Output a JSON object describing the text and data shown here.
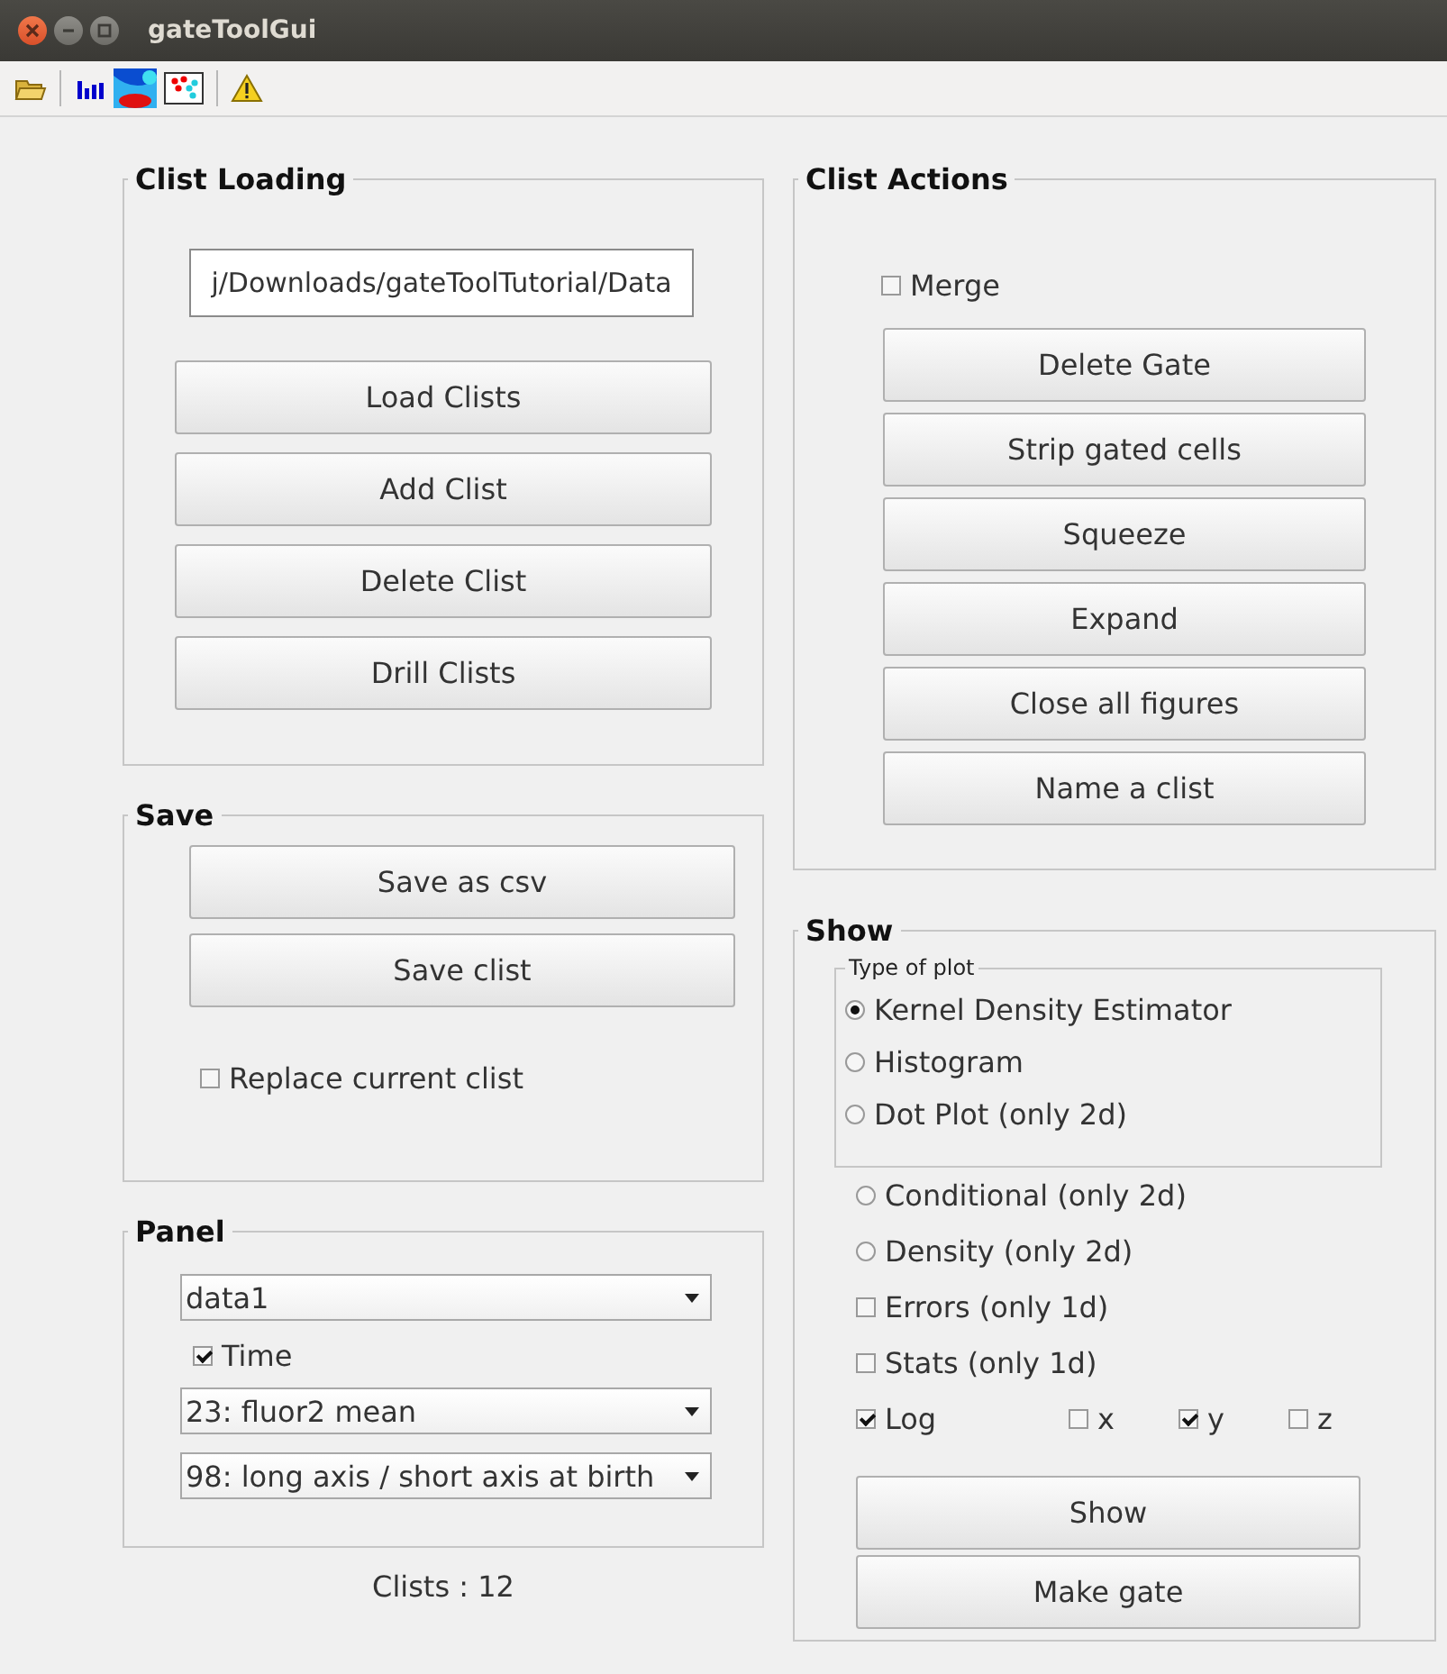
{
  "window": {
    "title": "gateToolGui"
  },
  "toolbar": [
    {
      "kind": "open"
    },
    {
      "kind": "separator"
    },
    {
      "kind": "bars"
    },
    {
      "kind": "heatmap"
    },
    {
      "kind": "scatter"
    },
    {
      "kind": "separator"
    },
    {
      "kind": "warning"
    }
  ],
  "clist_loading": {
    "title": "Clist Loading",
    "path_field": {
      "value": "j/Downloads/gateToolTutorial/Data"
    },
    "buttons": [
      "Load Clists",
      "Add Clist",
      "Delete Clist",
      "Drill Clists"
    ]
  },
  "save": {
    "title": "Save",
    "buttons": [
      "Save as csv",
      "Save clist"
    ],
    "replace_checkbox": {
      "label": "Replace current clist",
      "checked": false
    }
  },
  "panel": {
    "title": "Panel",
    "items": [
      {
        "kind": "dropdown",
        "value": "data1"
      },
      {
        "kind": "checkbox",
        "label": "Time",
        "checked": true
      },
      {
        "kind": "dropdown",
        "value": "23: fluor2 mean"
      },
      {
        "kind": "dropdown",
        "value": "98: long axis / short axis at birth"
      }
    ]
  },
  "status": "Clists : 12",
  "clist_actions": {
    "title": "Clist Actions",
    "merge": {
      "label": "Merge",
      "checked": false
    },
    "buttons": [
      "Delete Gate",
      "Strip gated cells",
      "Squeeze",
      "Expand",
      "Close all figures",
      "Name a clist"
    ]
  },
  "show": {
    "title": "Show",
    "type_of_plot": {
      "title": "Type of plot",
      "options": [
        {
          "label": "Kernel Density Estimator",
          "selected": true
        },
        {
          "label": "Histogram",
          "selected": false
        },
        {
          "label": "Dot Plot (only 2d)",
          "selected": false
        }
      ]
    },
    "options": [
      {
        "kind": "radio",
        "label": "Conditional (only 2d)",
        "selected": false
      },
      {
        "kind": "radio",
        "label": "Density (only 2d)",
        "selected": false
      },
      {
        "kind": "checkbox",
        "label": "Errors (only 1d)",
        "checked": false
      },
      {
        "kind": "checkbox",
        "label": "Stats (only 1d)",
        "checked": false
      }
    ],
    "log_row": [
      {
        "label": "Log",
        "checked": true
      },
      {
        "label": "x",
        "checked": false
      },
      {
        "label": "y",
        "checked": true
      },
      {
        "label": "z",
        "checked": false
      }
    ],
    "buttons": [
      "Show",
      "Make gate"
    ]
  }
}
